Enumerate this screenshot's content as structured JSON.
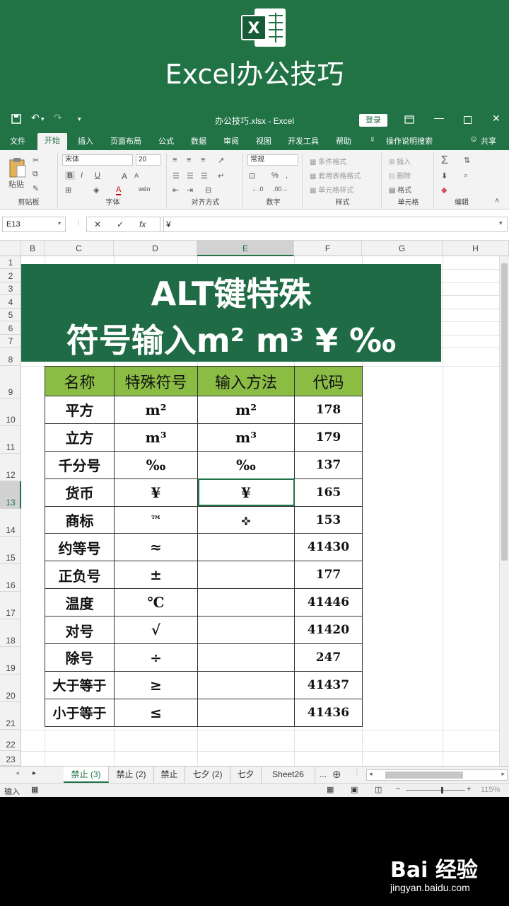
{
  "banner": {
    "title": "Excel办公技巧",
    "logo_letter": "X"
  },
  "titlebar": {
    "document_title": "办公技巧.xlsx - Excel",
    "login": "登录",
    "icons": [
      "save-icon",
      "undo-icon",
      "redo-icon",
      "customize-icon",
      "restore-ribbon-icon",
      "minimize-icon",
      "maximize-icon",
      "close-icon"
    ]
  },
  "ribbon_tabs": [
    "文件",
    "开始",
    "插入",
    "页面布局",
    "公式",
    "数据",
    "审阅",
    "视图",
    "开发工具",
    "帮助",
    "操作说明搜索",
    "共享"
  ],
  "ribbon": {
    "clipboard": {
      "paste": "粘贴",
      "label": "剪贴板"
    },
    "font": {
      "name": "宋体",
      "size": "20",
      "label": "字体",
      "bold": "B",
      "italic": "I",
      "underline": "U",
      "grow": "A",
      "shrink": "A",
      "fill": "A",
      "wen": "wén"
    },
    "alignment": {
      "label": "对齐方式"
    },
    "number": {
      "format": "常规",
      "label": "数字",
      "percent": "%",
      "comma": ","
    },
    "styles": {
      "conditional": "条件格式",
      "table": "套用表格格式",
      "cell": "单元格样式",
      "label": "样式"
    },
    "cells": {
      "insert": "插入",
      "delete": "删除",
      "format": "格式",
      "label": "单元格"
    },
    "editing": {
      "label": "编辑"
    }
  },
  "formula_bar": {
    "name_box": "E13",
    "cancel": "✕",
    "enter": "✓",
    "fx": "fx",
    "value": "¥"
  },
  "columns": [
    "B",
    "C",
    "D",
    "E",
    "F",
    "G",
    "H"
  ],
  "rows": [
    "1",
    "2",
    "3",
    "4",
    "5",
    "6",
    "7",
    "8",
    "9",
    "10",
    "11",
    "12",
    "13",
    "14",
    "15",
    "16",
    "17",
    "18",
    "19",
    "20",
    "21",
    "22",
    "23"
  ],
  "title_block": {
    "line1": "ALT键特殊",
    "line2": "符号输入m² m³ ¥ ‰"
  },
  "table": {
    "headers": [
      "名称",
      "特殊符号",
      "输入方法",
      "代码"
    ],
    "rows": [
      {
        "name": "平方",
        "symbol": "m²",
        "method": "m²",
        "code": "178"
      },
      {
        "name": "立方",
        "symbol": "m³",
        "method": "m³",
        "code": "179"
      },
      {
        "name": "千分号",
        "symbol": "‰",
        "method": "‰",
        "code": "137"
      },
      {
        "name": "货币",
        "symbol": "¥",
        "method": "¥",
        "code": "165"
      },
      {
        "name": "商标",
        "symbol": "™",
        "method": "",
        "code": "153"
      },
      {
        "name": "约等号",
        "symbol": "≈",
        "method": "",
        "code": "41430"
      },
      {
        "name": "正负号",
        "symbol": "±",
        "method": "",
        "code": "177"
      },
      {
        "name": "温度",
        "symbol": "℃",
        "method": "",
        "code": "41446"
      },
      {
        "name": "对号",
        "symbol": "√",
        "method": "",
        "code": "41420"
      },
      {
        "name": "除号",
        "symbol": "÷",
        "method": "",
        "code": "247"
      },
      {
        "name": "大于等于",
        "symbol": "≥",
        "method": "",
        "code": "41437"
      },
      {
        "name": "小于等于",
        "symbol": "≤",
        "method": "",
        "code": "41436"
      }
    ]
  },
  "sheet_tabs": [
    "禁止 (3)",
    "禁止 (2)",
    "禁止",
    "七夕 (2)",
    "七夕",
    "Sheet26",
    "..."
  ],
  "active_sheet": "禁止 (3)",
  "status": {
    "mode": "输入",
    "zoom": "115%"
  },
  "watermark": {
    "brand": "Bai 经验",
    "url": "jingyan.baidu.com"
  },
  "colors": {
    "excel_green": "#217346",
    "title_bg": "#1e6b45",
    "header_fill": "#8bbd45"
  }
}
